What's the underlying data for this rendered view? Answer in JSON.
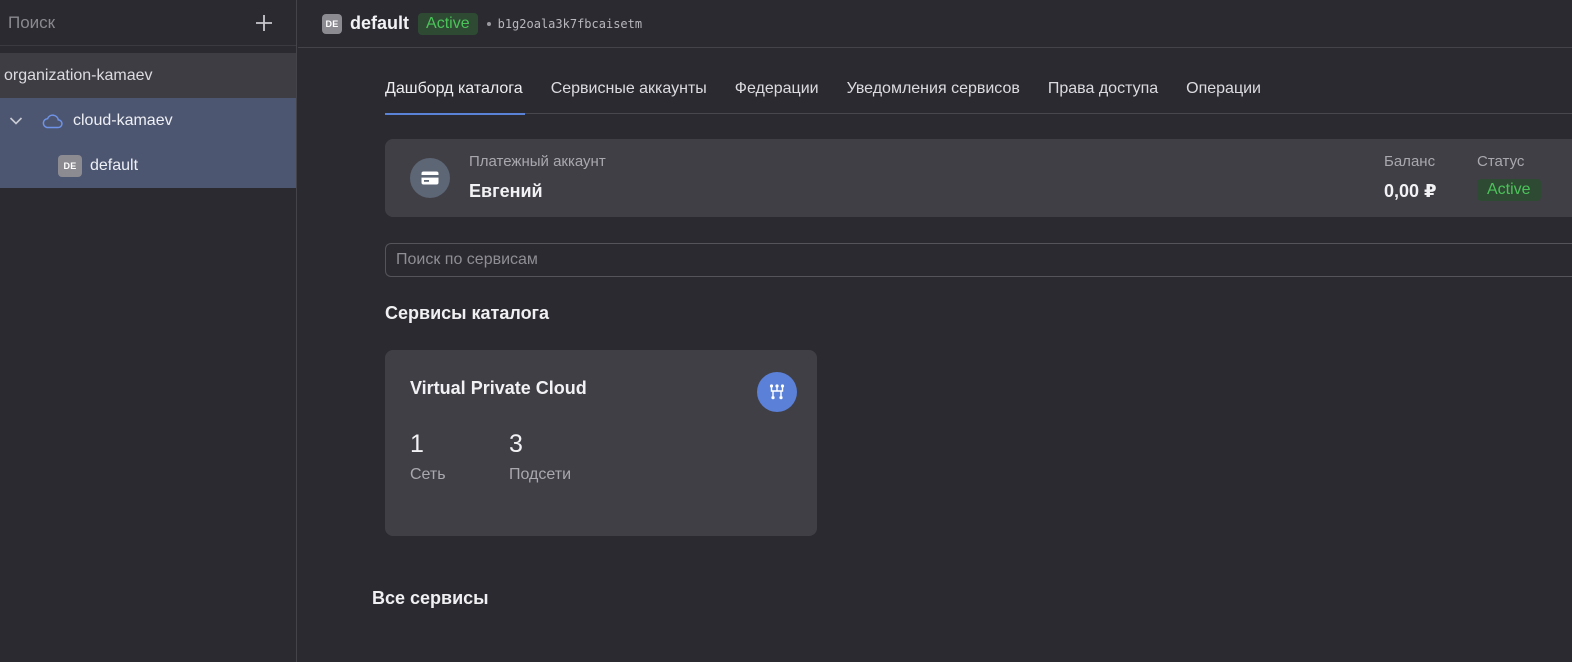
{
  "sidebar": {
    "search_placeholder": "Поиск",
    "add_icon": "plus-icon",
    "organization": "organization-kamaev",
    "cloud": {
      "name": "cloud-kamaev",
      "icon": "cloud-icon",
      "expanded": true
    },
    "folder": {
      "badge": "DE",
      "name": "default"
    }
  },
  "header": {
    "badge": "DE",
    "title": "default",
    "status": "Active",
    "id": "b1g2oala3k7fbcaisetm"
  },
  "tabs": [
    {
      "label": "Дашборд каталога",
      "active": true
    },
    {
      "label": "Сервисные аккаунты",
      "active": false
    },
    {
      "label": "Федерации",
      "active": false
    },
    {
      "label": "Уведомления сервисов",
      "active": false
    },
    {
      "label": "Права доступа",
      "active": false
    },
    {
      "label": "Операции",
      "active": false
    }
  ],
  "billing": {
    "icon": "credit-card-icon",
    "caption": "Платежный аккаунт",
    "name": "Евгений",
    "balance_caption": "Баланс",
    "balance_value": "0,00 ₽",
    "status_caption": "Статус",
    "status": "Active"
  },
  "service_search": {
    "placeholder": "Поиск по сервисам",
    "value": ""
  },
  "catalog_services": {
    "title": "Сервисы каталога",
    "cards": [
      {
        "title": "Virtual Private Cloud",
        "icon": "network-icon",
        "metrics": [
          {
            "value": "1",
            "label": "Сеть"
          },
          {
            "value": "3",
            "label": "Подсети"
          }
        ]
      }
    ]
  },
  "all_services": {
    "title": "Все сервисы"
  },
  "colors": {
    "background": "#2b2a30",
    "card": "#403f46",
    "selected_row": "#4d5670",
    "accent": "#5a82d6",
    "status_green": "#4cc35a"
  }
}
